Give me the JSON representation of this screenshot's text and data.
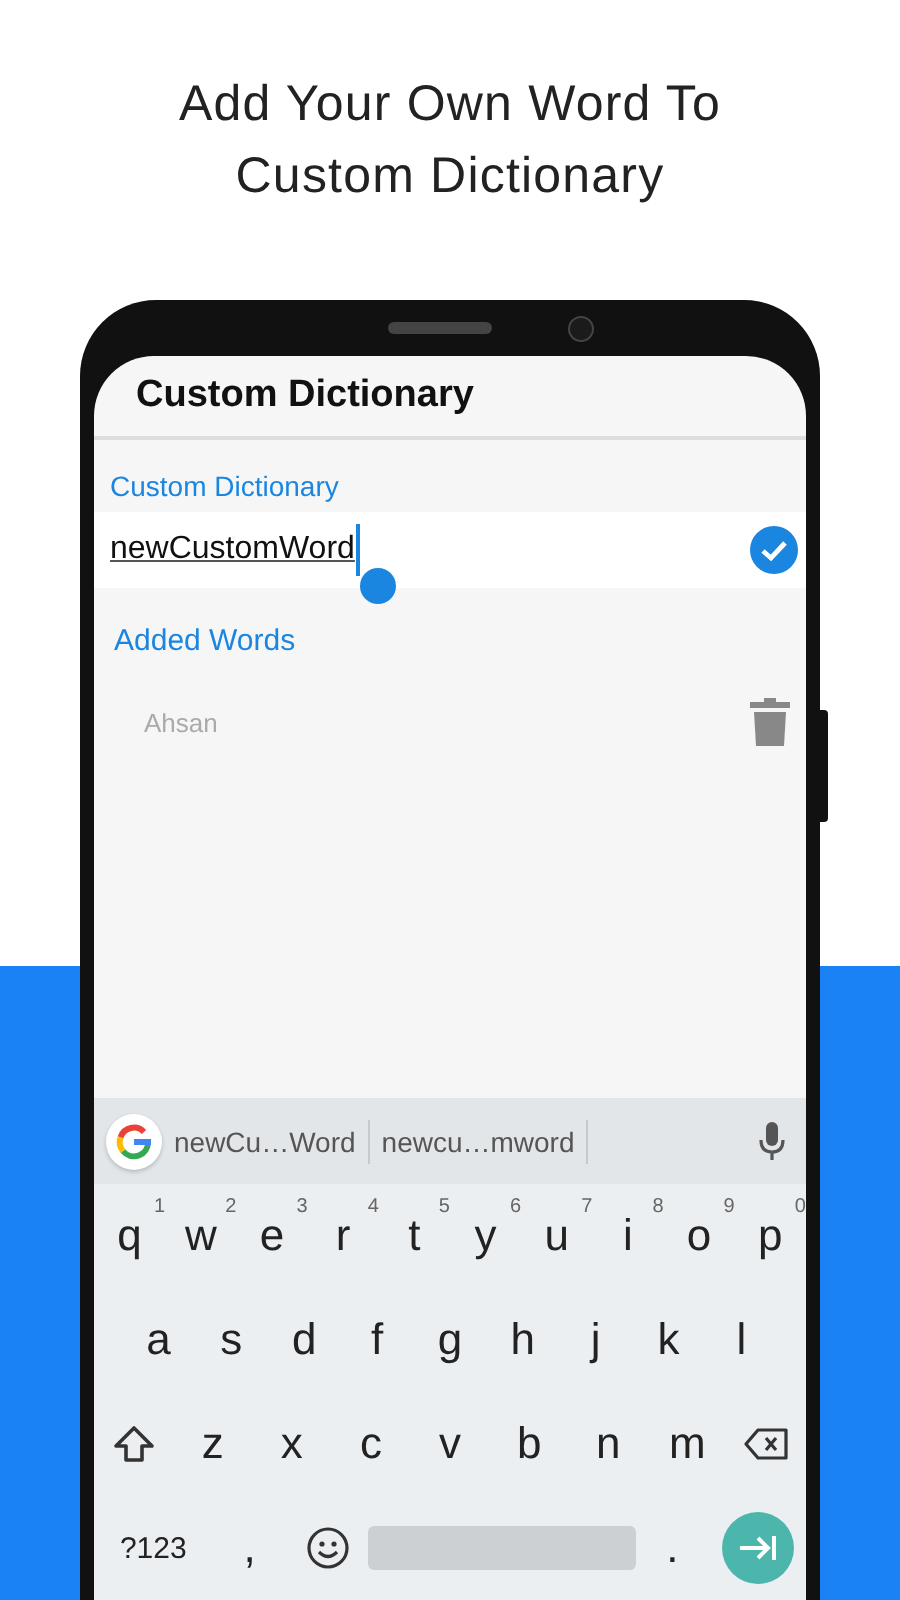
{
  "headline": "Add Your Own Word To Custom Dictionary",
  "app_bar": {
    "title": "Custom Dictionary"
  },
  "word_field": {
    "label": "Custom Dictionary",
    "value": "newCustomWord"
  },
  "added_words": {
    "label": "Added Words",
    "items": [
      {
        "word": "Ahsan"
      }
    ]
  },
  "keyboard": {
    "suggestions": [
      "newCu…Word",
      "newcu…mword"
    ],
    "rows": [
      [
        {
          "kind": "char",
          "label": "q",
          "hint": "1"
        },
        {
          "kind": "char",
          "label": "w",
          "hint": "2"
        },
        {
          "kind": "char",
          "label": "e",
          "hint": "3"
        },
        {
          "kind": "char",
          "label": "r",
          "hint": "4"
        },
        {
          "kind": "char",
          "label": "t",
          "hint": "5"
        },
        {
          "kind": "char",
          "label": "y",
          "hint": "6"
        },
        {
          "kind": "char",
          "label": "u",
          "hint": "7"
        },
        {
          "kind": "char",
          "label": "i",
          "hint": "8"
        },
        {
          "kind": "char",
          "label": "o",
          "hint": "9"
        },
        {
          "kind": "char",
          "label": "p",
          "hint": "0"
        }
      ],
      [
        {
          "kind": "char",
          "label": "a"
        },
        {
          "kind": "char",
          "label": "s"
        },
        {
          "kind": "char",
          "label": "d"
        },
        {
          "kind": "char",
          "label": "f"
        },
        {
          "kind": "char",
          "label": "g"
        },
        {
          "kind": "char",
          "label": "h"
        },
        {
          "kind": "char",
          "label": "j"
        },
        {
          "kind": "char",
          "label": "k"
        },
        {
          "kind": "char",
          "label": "l"
        }
      ],
      [
        {
          "kind": "shift"
        },
        {
          "kind": "char",
          "label": "z"
        },
        {
          "kind": "char",
          "label": "x"
        },
        {
          "kind": "char",
          "label": "c"
        },
        {
          "kind": "char",
          "label": "v"
        },
        {
          "kind": "char",
          "label": "b"
        },
        {
          "kind": "char",
          "label": "n"
        },
        {
          "kind": "char",
          "label": "m"
        },
        {
          "kind": "backspace"
        }
      ],
      [
        {
          "kind": "symbols",
          "label": "?123"
        },
        {
          "kind": "char",
          "label": ","
        },
        {
          "kind": "emoji"
        },
        {
          "kind": "space"
        },
        {
          "kind": "char",
          "label": "."
        },
        {
          "kind": "enter"
        }
      ]
    ]
  }
}
